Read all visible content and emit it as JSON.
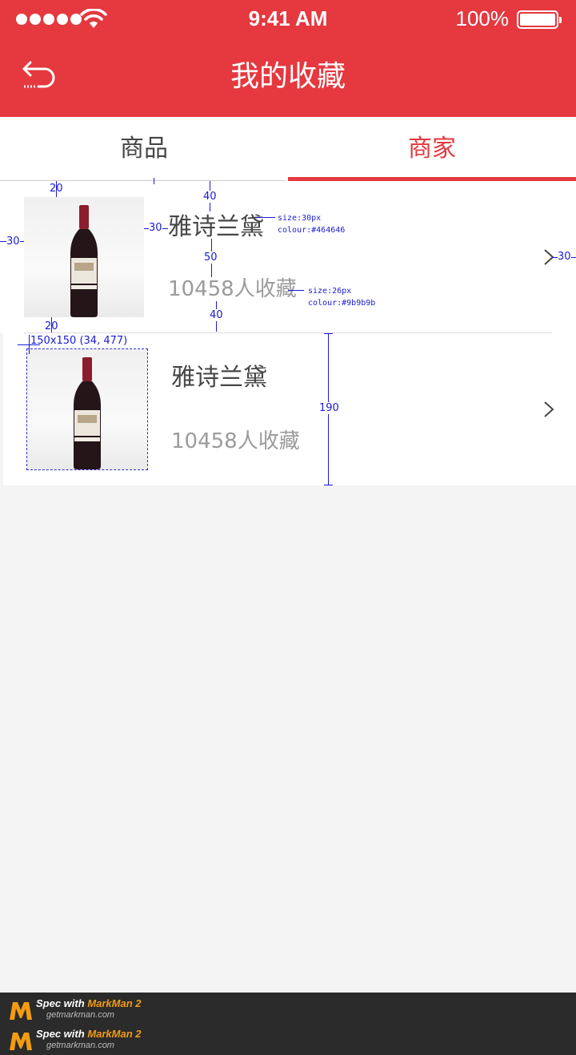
{
  "status_bar": {
    "time": "9:41 AM",
    "battery": "100%"
  },
  "nav": {
    "title": "我的收藏"
  },
  "tabs": [
    {
      "label": "商品",
      "active": false
    },
    {
      "label": "商家",
      "active": true
    }
  ],
  "items": [
    {
      "name": "雅诗兰黛",
      "favorites": "10458人收藏"
    },
    {
      "name": "雅诗兰黛",
      "favorites": "10458人收藏"
    }
  ],
  "annotations": {
    "item1_top_pad": "20",
    "item1_text_top": "40",
    "item1_left_pad": "30",
    "item1_img_gap": "30",
    "item1_text_gap": "50",
    "item1_bottom_text": "40",
    "item1_bottom_pad": "20",
    "item1_right_pad": "30",
    "name_spec_size": "size:30px",
    "name_spec_colour": "colour:#464646",
    "count_spec_size": "size:26px",
    "count_spec_colour": "colour:#9b9b9b",
    "item2_image_spec": "150x150 (34, 477)",
    "item2_height": "190"
  },
  "footer": {
    "badge_prefix": "Spec with",
    "badge_brand": "MarkMan 2",
    "badge_url": "getmarkman.com"
  },
  "colors": {
    "accent": "#e5383f",
    "name_text": "#464646",
    "count_text": "#9b9b9b"
  }
}
